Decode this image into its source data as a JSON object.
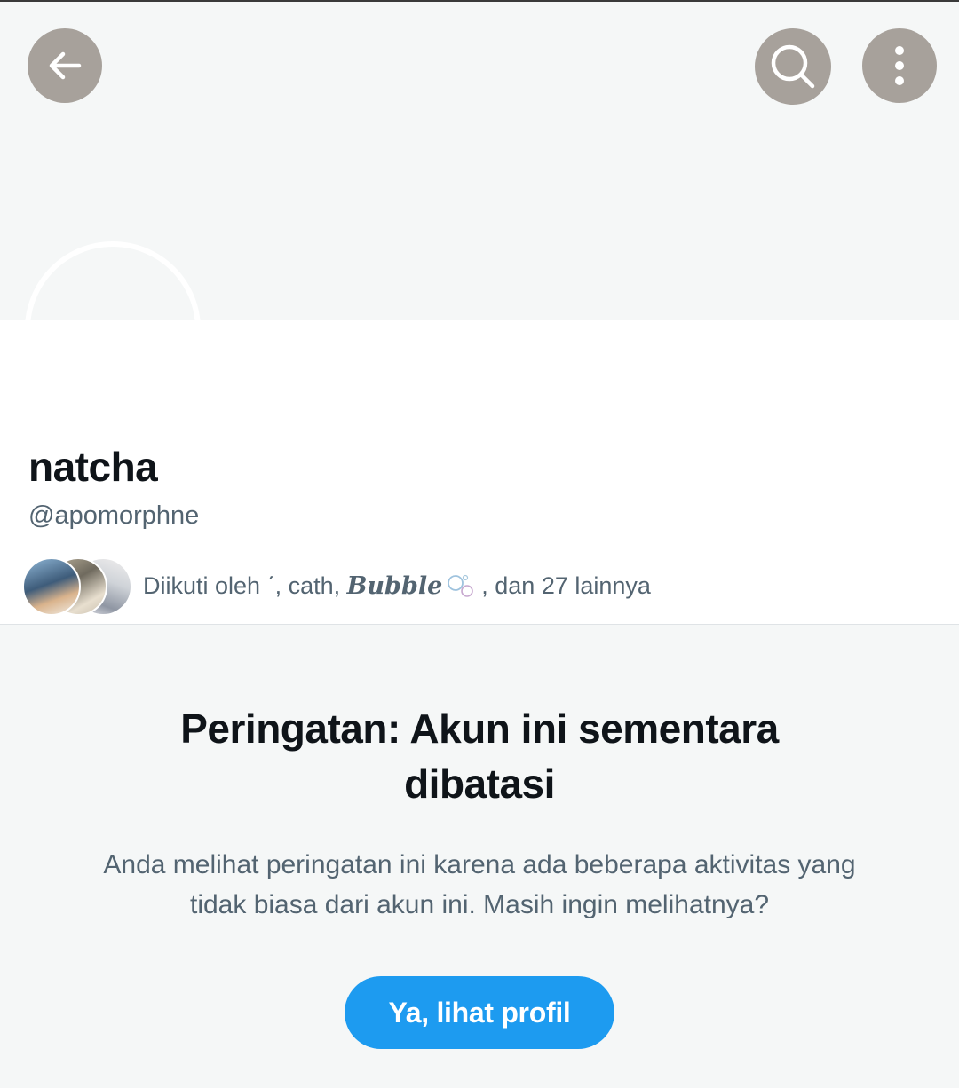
{
  "header": {
    "back_icon": "arrow-left-icon",
    "search_icon": "search-icon",
    "more_icon": "more-vertical-icon",
    "button_color": "#a7a19b"
  },
  "profile": {
    "display_name": "natcha",
    "handle": "@apomorphne",
    "followed_by": {
      "prefix": "Diikuti oleh ",
      "name1": "ˊ",
      "sep1": ", cath, ",
      "name_styled": "Bubble",
      "bubble_icon": "soap-bubbles-icon",
      "suffix": ", dan 27 lainnya"
    }
  },
  "warning": {
    "title": "Peringatan: Akun ini sementara dibatasi",
    "body": "Anda melihat peringatan ini karena ada beberapa aktivitas yang tidak biasa dari akun ini. Masih ingin melihatnya?",
    "button_label": "Ya, lihat profil",
    "button_color": "#1d9bf0"
  }
}
